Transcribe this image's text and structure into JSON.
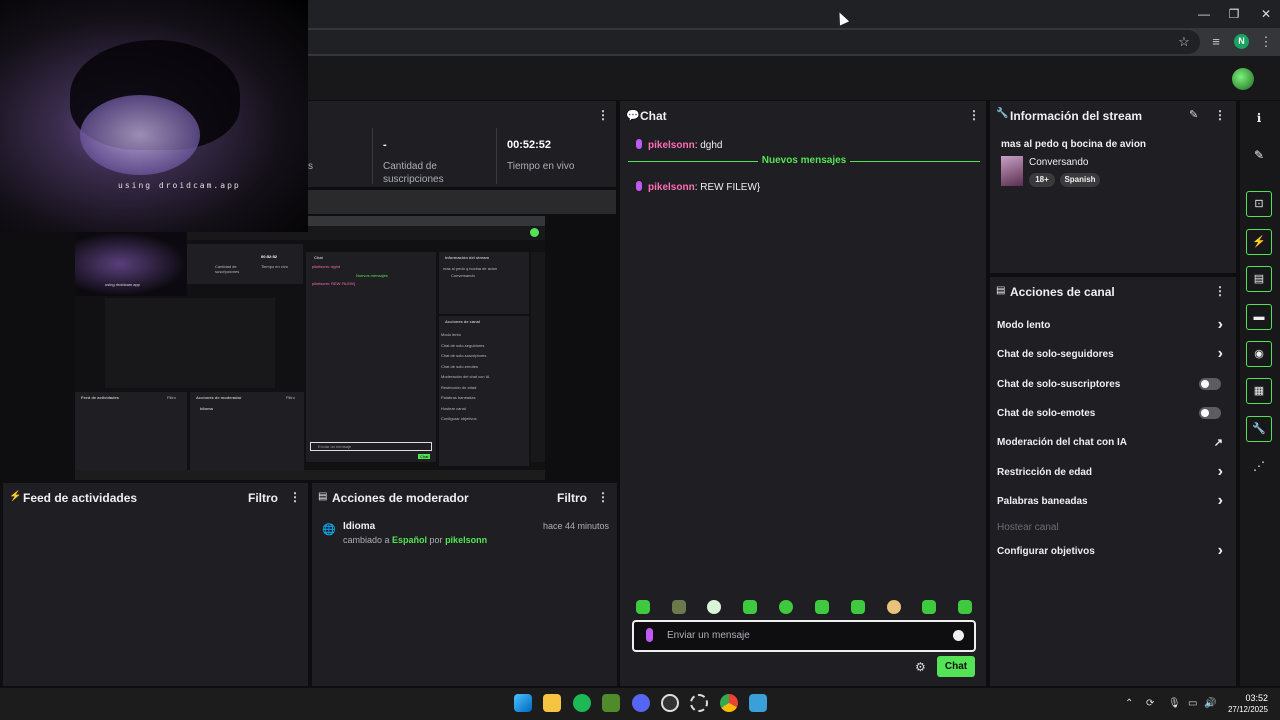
{
  "window": {
    "minimize": "—",
    "restore": "❐",
    "close": "✕",
    "profile_initial": "N"
  },
  "stats": {
    "item1_label_fragment": "s",
    "subs_value": "-",
    "subs_label_line1": "Cantidad de",
    "subs_label_line2": "suscripciones",
    "live_value": "00:52:52",
    "live_label": "Tiempo en vivo"
  },
  "webcam": {
    "overlay_text": "using droidcam.app"
  },
  "chat": {
    "title": "Chat",
    "messages": [
      {
        "user": "pikelsonn",
        "text": ": dghd"
      },
      {
        "user": "pikelsonn",
        "text": ": REW FILEW}"
      }
    ],
    "new_messages_label": "Nuevos mensajes",
    "input_placeholder": "Enviar un mensaje",
    "send_label": "Chat"
  },
  "stream_info": {
    "title": "Información del stream",
    "stream_title": "mas al pedo q bocina de avion",
    "category": "Conversando",
    "tags": [
      "18+",
      "Spanish"
    ]
  },
  "channel_actions": {
    "title": "Acciones de canal",
    "items": [
      {
        "label": "Modo lento",
        "control": "chevron"
      },
      {
        "label": "Chat de solo-seguidores",
        "control": "chevron"
      },
      {
        "label": "Chat de solo-suscriptores",
        "control": "toggle"
      },
      {
        "label": "Chat de solo-emotes",
        "control": "toggle"
      },
      {
        "label": "Moderación del chat con IA",
        "control": "external"
      },
      {
        "label": "Restricción de edad",
        "control": "chevron"
      },
      {
        "label": "Palabras baneadas",
        "control": "chevron"
      },
      {
        "label": "Hostear canal",
        "control": "none"
      },
      {
        "label": "Configurar objetivos",
        "control": "chevron"
      }
    ]
  },
  "activity_feed": {
    "title": "Feed de actividades",
    "filter_label": "Filtro"
  },
  "mod_actions": {
    "title": "Acciones de moderador",
    "filter_label": "Filtro",
    "entry": {
      "heading": "Idioma",
      "time": "hace 44 minutos",
      "prefix": "cambiado a ",
      "language": "Español",
      "middle": " por ",
      "user": "pikelsonn"
    }
  },
  "nested_capture": {
    "chat_title": "Chat",
    "info_title": "Información del stream",
    "actions_title": "Acciones de canal",
    "feed_title": "Feed de actividades",
    "mod_title": "Acciones de moderador",
    "filter": "Filtro",
    "idioma": "Idioma",
    "input": "Enviar un mensaje",
    "send": "Chat",
    "new_messages": "Nuevos mensajes",
    "msg1": "pikelsonn: dghd",
    "msg2": "pikelsonn: REW FILEW}",
    "stream_title": "mas al pedo q bocina de avion",
    "category": "Conversando",
    "live_value": "00:52:52",
    "live_label": "Tiempo en vivo",
    "subs_label": "Cantidad de suscripciones",
    "actions": [
      "Modo lento",
      "Chat de solo-seguidores",
      "Chat de solo-suscriptores",
      "Chat de solo-emotes",
      "Moderación del chat con IA",
      "Restricción de edad",
      "Palabras baneadas",
      "Hostear canal",
      "Configurar objetivos"
    ],
    "webcam_text": "using droidcam.app"
  },
  "taskbar": {
    "time": "03:52",
    "date": "27/12/2025"
  },
  "colors": {
    "accent": "#54e354",
    "username": "#ff6db5",
    "panel": "#1f1f23",
    "background": "#0e0e10"
  }
}
